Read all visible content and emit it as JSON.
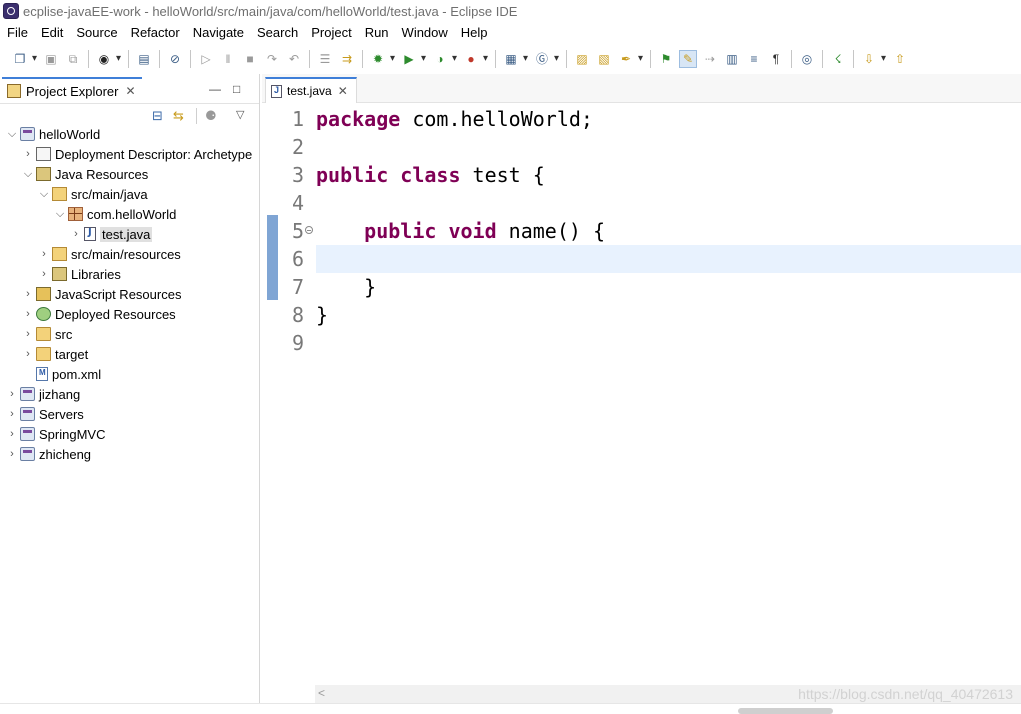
{
  "window": {
    "title": "ecplise-javaEE-work - helloWorld/src/main/java/com/helloWorld/test.java - Eclipse IDE"
  },
  "menu": [
    "File",
    "Edit",
    "Source",
    "Refactor",
    "Navigate",
    "Search",
    "Project",
    "Run",
    "Window",
    "Help"
  ],
  "toolbar_icons": [
    "new-icon",
    "save-icon",
    "save-all-icon",
    "profile-icon",
    "console-icon",
    "skip-breakpoints-icon",
    "resume-icon",
    "suspend-icon",
    "terminate-icon",
    "step-over-icon",
    "step-return-icon",
    "debug-icon",
    "run-icon",
    "coverage-icon",
    "external-tools-icon",
    "new-server-icon",
    "new-class-icon",
    "open-type-icon",
    "search-icon",
    "task-icon",
    "annotation-icon",
    "highlight-icon",
    "show-whitespace-icon",
    "web-browser-icon",
    "open-perspective-icon",
    "next-annotation-icon"
  ],
  "project_explorer": {
    "tab_label": "Project Explorer",
    "tree": [
      {
        "label": "helloWorld",
        "depth": 0,
        "expanded": true,
        "icon": "project-icon"
      },
      {
        "label": "Deployment Descriptor: Archetype",
        "depth": 1,
        "expanded": false,
        "icon": "descriptor-icon"
      },
      {
        "label": "Java Resources",
        "depth": 1,
        "expanded": true,
        "icon": "java-resources-icon"
      },
      {
        "label": "src/main/java",
        "depth": 2,
        "expanded": true,
        "icon": "source-folder-icon"
      },
      {
        "label": "com.helloWorld",
        "depth": 3,
        "expanded": true,
        "icon": "package-icon"
      },
      {
        "label": "test.java",
        "depth": 4,
        "expanded": false,
        "icon": "java-file-icon",
        "selected": true
      },
      {
        "label": "src/main/resources",
        "depth": 2,
        "expanded": false,
        "icon": "source-folder-icon"
      },
      {
        "label": "Libraries",
        "depth": 2,
        "expanded": false,
        "icon": "libraries-icon"
      },
      {
        "label": "JavaScript Resources",
        "depth": 1,
        "expanded": false,
        "icon": "javascript-icon"
      },
      {
        "label": "Deployed Resources",
        "depth": 1,
        "expanded": false,
        "icon": "deployed-icon"
      },
      {
        "label": "src",
        "depth": 1,
        "expanded": false,
        "icon": "folder-icon"
      },
      {
        "label": "target",
        "depth": 1,
        "expanded": false,
        "icon": "folder-icon"
      },
      {
        "label": "pom.xml",
        "depth": 1,
        "leaf": true,
        "icon": "xml-file-icon"
      },
      {
        "label": "jizhang",
        "depth": 0,
        "expanded": false,
        "icon": "project-icon"
      },
      {
        "label": "Servers",
        "depth": 0,
        "expanded": false,
        "icon": "project-icon"
      },
      {
        "label": "SpringMVC",
        "depth": 0,
        "expanded": false,
        "icon": "project-icon"
      },
      {
        "label": "zhicheng",
        "depth": 0,
        "expanded": false,
        "icon": "project-icon"
      }
    ]
  },
  "editor": {
    "tab_label": "test.java",
    "lines": [
      {
        "num": "1",
        "tokens": [
          {
            "t": "package",
            "kw": true
          },
          {
            "t": " com.helloWorld;"
          }
        ]
      },
      {
        "num": "2",
        "tokens": []
      },
      {
        "num": "3",
        "tokens": [
          {
            "t": "public",
            "kw": true
          },
          {
            "t": " "
          },
          {
            "t": "class",
            "kw": true
          },
          {
            "t": " test {"
          }
        ]
      },
      {
        "num": "4",
        "tokens": []
      },
      {
        "num": "5",
        "tokens": [
          {
            "t": "    "
          },
          {
            "t": "public",
            "kw": true
          },
          {
            "t": " "
          },
          {
            "t": "void",
            "kw": true
          },
          {
            "t": " name() {"
          }
        ],
        "fold": true
      },
      {
        "num": "6",
        "tokens": [],
        "current": true
      },
      {
        "num": "7",
        "tokens": [
          {
            "t": "    }"
          }
        ]
      },
      {
        "num": "8",
        "tokens": [
          {
            "t": "}"
          }
        ]
      },
      {
        "num": "9",
        "tokens": []
      }
    ]
  },
  "watermark": "https://blog.csdn.net/qq_40472613",
  "scroll_left_glyph": "<"
}
